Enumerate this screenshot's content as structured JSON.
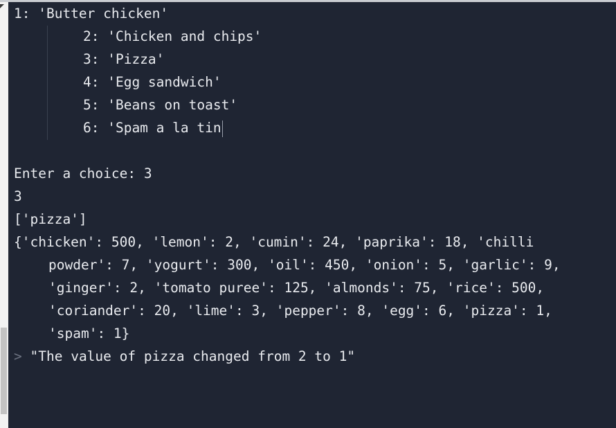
{
  "menu_lines": [
    "1: 'Butter chicken'",
    "2: 'Chicken and chips'",
    "3: 'Pizza'",
    "4: 'Egg sandwich'",
    "5: 'Beans on toast'",
    "6: 'Spam a la tin"
  ],
  "input_line": "Enter a choice: 3",
  "echo_value": "3",
  "selection_list": "['pizza']",
  "dict_lines": [
    "{'chicken': 500, 'lemon': 2, 'cumin': 24, 'paprika': 18, 'chilli",
    "powder': 7, 'yogurt': 300, 'oil': 450, 'onion': 5, 'garlic': 9,",
    "'ginger': 2, 'tomato puree': 125, 'almonds': 75, 'rice': 500,",
    "'coriander': 20, 'lime': 3, 'pepper': 8, 'egg': 6, 'pizza': 1,",
    "'spam': 1}"
  ],
  "result_prompt": ">",
  "result_text": "\"The value of pizza changed from 2 to 1\""
}
